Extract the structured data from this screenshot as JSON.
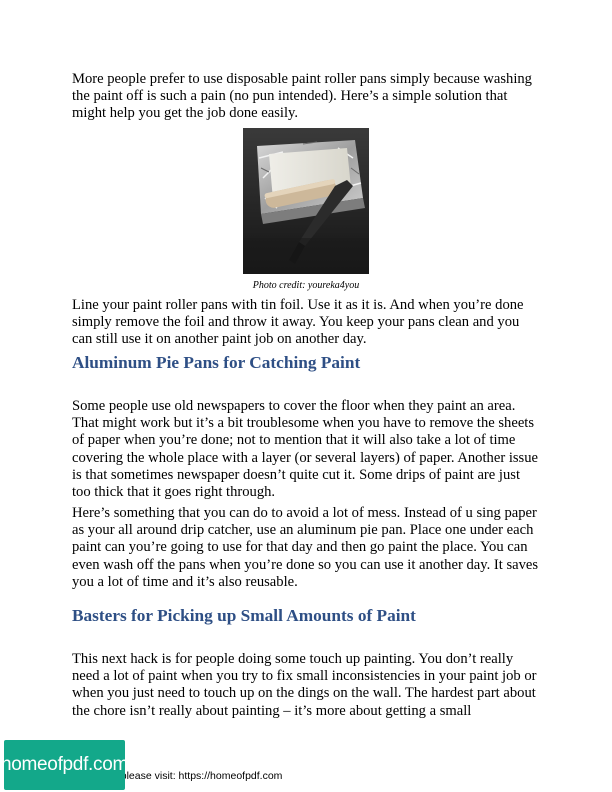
{
  "intro": {
    "paragraph": "More people prefer to use disposable paint roller pans simply because washing the paint off is such a pain (no pun intended). Here’s a simple solution that might help you get the job done easily."
  },
  "figure": {
    "caption": "Photo credit: youreka4you"
  },
  "foil": {
    "paragraph": "Line your paint roller pans with tin foil. Use it as it is. And when you’re done simply remove the foil and throw it away. You keep your pans clean and you can still use it on another paint job on another day."
  },
  "section_pie_pans": {
    "heading": "Aluminum Pie Pans for Catching Paint",
    "paragraph_1": "Some people use old newspapers to cover the floor when they paint an area. That might work but it’s a bit troublesome when you have to remove the sheets of paper when you’re done; not to mention that it will also take a lot of time covering the whole place with a layer (or several layers) of paper. Another issue is that sometimes newspaper doesn’t quite cut it. Some drips of paint are just too thick that it goes right through.",
    "paragraph_2": "Here’s something that you can do to avoid a lot of mess. Instead of u sing paper as your all around drip catcher, use an aluminum pie pan. Place one under each paint can you’re going to use for that day and then go paint the place. You can even wash off the pans when you’re done so you can use it another day. It saves you a lot of time and it’s also reusable."
  },
  "section_basters": {
    "heading": "Basters for Picking up Small Amounts of Paint",
    "paragraph_1": "This next hack is for people doing some touch up painting. You don’t really need a lot of paint when you try to fix small inconsistencies in your paint job or when you just need to touch up on the dings on the wall. The hardest part about the chore isn’t really about painting – it’s more about getting a small"
  },
  "footer": {
    "badge_text": "homeofpdf.com",
    "note": "e please visit: https://homeofpdf.com"
  },
  "colors": {
    "heading": "#2e4f85",
    "badge": "#13a88a"
  }
}
